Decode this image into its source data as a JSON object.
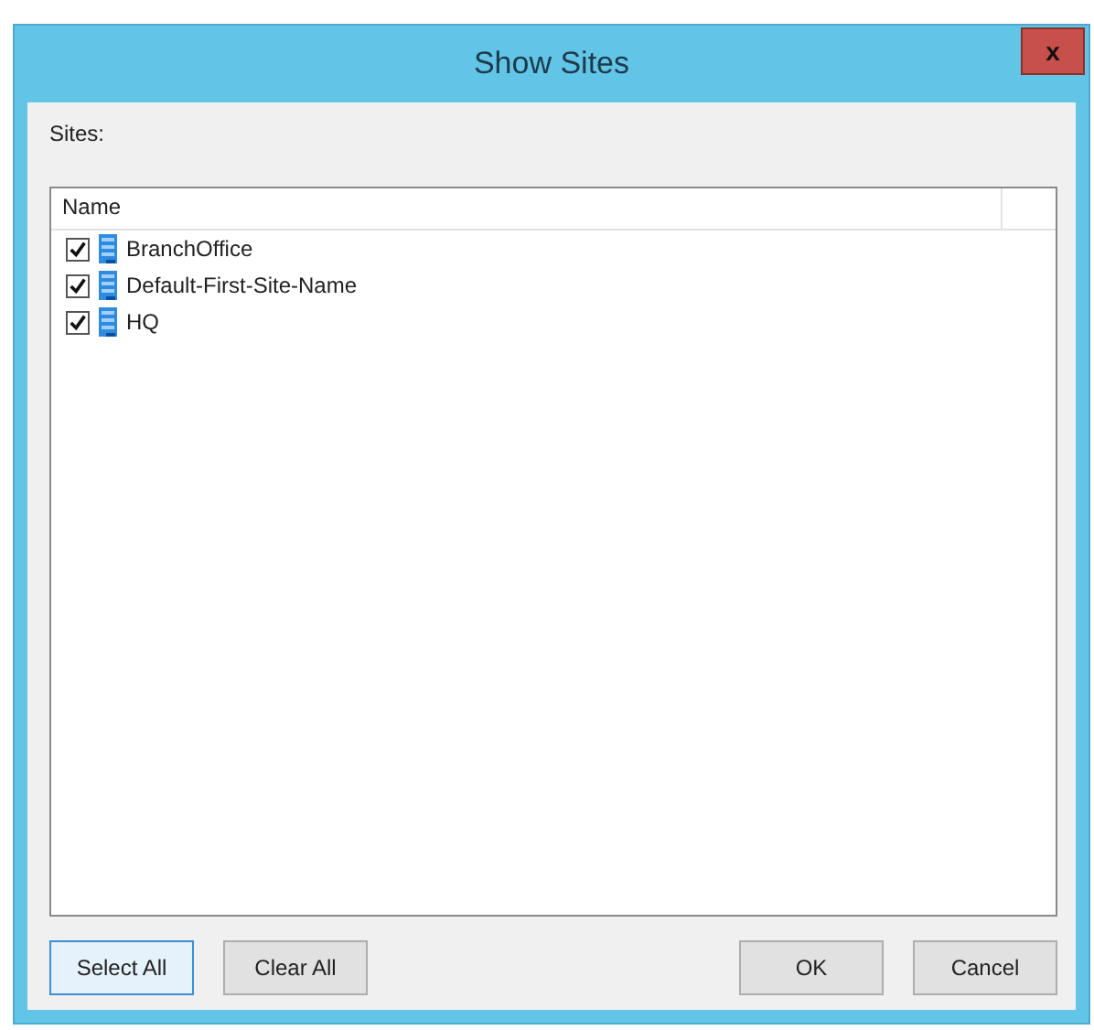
{
  "window": {
    "title": "Show Sites",
    "close": "x"
  },
  "label": "Sites:",
  "list": {
    "columns": [
      "Name"
    ],
    "rows": [
      {
        "name": "BranchOffice",
        "checked": true
      },
      {
        "name": "Default-First-Site-Name",
        "checked": true
      },
      {
        "name": "HQ",
        "checked": true
      }
    ]
  },
  "buttons_left": [
    "Select All",
    "Clear All"
  ],
  "buttons_right": [
    "OK",
    "Cancel"
  ]
}
